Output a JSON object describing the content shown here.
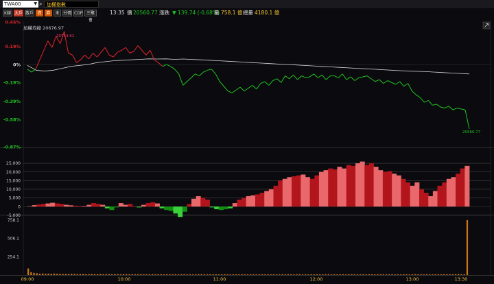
{
  "header": {
    "ticker_value": "TWA00",
    "index_name": "加權指數"
  },
  "toolbar": {
    "buttons": [
      "K線",
      "大戶",
      "散戶",
      "資",
      "券",
      "未",
      "分價",
      "CDP",
      "三聚會"
    ],
    "time": "13:35",
    "price_label": "價",
    "price_value": "20560.77",
    "change_label": "漲跌",
    "change_arrow": "▼",
    "change_value": "139.74 (-0.68%)",
    "volume_label": "量",
    "volume_value": "758.1 億",
    "total_label": "總量",
    "total_value": "4180.1 億"
  },
  "colors": {
    "up": "#e0252b",
    "down": "#21c321",
    "avg_line": "#d8d8d8",
    "accent": "#f4c430"
  },
  "chart_data": [
    {
      "type": "line",
      "title": "加權均線 20676.97",
      "ytick_labels": [
        "0.45%",
        "0.19%",
        "0%",
        "-0.19%",
        "-0.39%",
        "-0.58%",
        "-0.87%"
      ],
      "ytick_values": [
        0.45,
        0.19,
        0,
        -0.19,
        -0.39,
        -0.58,
        -0.87
      ],
      "ylim": [
        -0.87,
        0.45
      ],
      "xlabels": [
        "09:00",
        "10:00",
        "11:00",
        "12:00",
        "13:00",
        "13:30"
      ],
      "annotations": {
        "high": "20754.61",
        "last": "20560.77"
      },
      "series": [
        {
          "values": [
            -0.05,
            -0.08,
            -0.05,
            0.05,
            0.15,
            0.25,
            0.18,
            0.3,
            0.22,
            0.35,
            0.12,
            0.1,
            0.02,
            0.05,
            0.1,
            0.06,
            0.12,
            0.08,
            0.13,
            0.18,
            0.1,
            0.08,
            0.13,
            0.15,
            0.18,
            0.12,
            0.14,
            0.2,
            0.15,
            0.1,
            0.15,
            0.05,
            0.02,
            -0.02,
            0.0,
            -0.02,
            -0.05,
            -0.1,
            -0.22,
            -0.18,
            -0.14,
            -0.1,
            -0.12,
            -0.08,
            -0.06,
            -0.05,
            -0.1,
            -0.18,
            -0.23,
            -0.28,
            -0.3,
            -0.27,
            -0.24,
            -0.28,
            -0.25,
            -0.22,
            -0.26,
            -0.2,
            -0.18,
            -0.22,
            -0.17,
            -0.15,
            -0.19,
            -0.12,
            -0.15,
            -0.11,
            -0.16,
            -0.12,
            -0.14,
            -0.13,
            -0.1,
            -0.14,
            -0.11,
            -0.16,
            -0.12,
            -0.12,
            -0.14,
            -0.1,
            -0.16,
            -0.13,
            -0.17,
            -0.14,
            -0.13,
            -0.12,
            -0.15,
            -0.18,
            -0.16,
            -0.2,
            -0.17,
            -0.19,
            -0.21,
            -0.18,
            -0.23,
            -0.2,
            -0.28,
            -0.32,
            -0.35,
            -0.4,
            -0.38,
            -0.43,
            -0.42,
            -0.45,
            -0.46,
            -0.44,
            -0.48,
            -0.46,
            -0.47,
            -0.48,
            -0.68
          ]
        },
        {
          "values": [
            -0.01,
            -0.06,
            -0.07,
            -0.06,
            -0.04,
            -0.02,
            -0.01,
            0.0,
            0.02,
            0.03,
            0.04,
            0.045,
            0.05,
            0.055,
            0.06,
            0.058,
            0.06,
            0.055,
            0.058,
            0.054,
            0.05,
            0.045,
            0.04,
            0.035,
            0.03,
            0.025,
            0.02,
            0.015,
            0.01,
            0.005,
            0.0,
            -0.005,
            -0.01,
            -0.015,
            -0.02,
            -0.025,
            -0.03,
            -0.035,
            -0.04,
            -0.045,
            -0.05,
            -0.055,
            -0.06,
            -0.065,
            -0.07,
            -0.072,
            -0.075,
            -0.08,
            -0.085,
            -0.09,
            -0.095,
            -0.1
          ]
        }
      ]
    },
    {
      "type": "area",
      "ytick_labels": [
        "25,000",
        "20,000",
        "15,000",
        "10,000",
        "5,000",
        "0",
        "-5,000"
      ],
      "ytick_values": [
        25000,
        20000,
        15000,
        10000,
        5000,
        0,
        -5000
      ],
      "ylim": [
        -5500,
        27000
      ],
      "values": [
        200,
        800,
        1200,
        1500,
        1800,
        2200,
        1800,
        1500,
        1000,
        700,
        500,
        400,
        300,
        1000,
        2000,
        1500,
        1000,
        -1000,
        -2000,
        -500,
        2000,
        1000,
        1500,
        300,
        -500,
        1000,
        2000,
        2500,
        1800,
        -1000,
        -2000,
        -2500,
        -4000,
        -6000,
        -3000,
        1500,
        4500,
        6000,
        5000,
        4000,
        -500,
        -1500,
        -2000,
        -1500,
        -1000,
        2000,
        4000,
        5000,
        6000,
        6500,
        7000,
        8000,
        9000,
        10000,
        12000,
        15000,
        16000,
        17000,
        17500,
        18000,
        18500,
        17000,
        16000,
        18000,
        20000,
        21000,
        22000,
        21500,
        23000,
        22000,
        24000,
        23500,
        25000,
        26000,
        24000,
        25000,
        23000,
        21000,
        20000,
        20500,
        19000,
        18000,
        16000,
        14000,
        12000,
        14000,
        10000,
        8000,
        6000,
        9000,
        12000,
        14000,
        16000,
        17000,
        19000,
        22000,
        23500
      ]
    },
    {
      "type": "bar",
      "ytick_labels": [
        "758.1",
        "506.1",
        "254.1"
      ],
      "ytick_values": [
        758.1,
        506.1,
        254.1
      ],
      "ylim": [
        0,
        775
      ],
      "values": [
        90,
        40,
        30,
        25,
        20,
        22,
        18,
        20,
        19,
        21,
        18,
        17,
        16,
        17,
        15,
        18,
        16,
        14,
        15,
        16,
        14,
        13,
        15,
        14,
        13,
        16,
        12,
        14,
        13,
        12,
        15,
        13,
        12,
        14,
        13,
        12,
        13,
        11,
        12,
        13,
        12,
        11,
        12,
        13,
        11,
        12,
        12,
        11,
        13,
        12,
        11,
        12,
        11,
        12,
        13,
        11,
        12,
        10,
        11,
        12,
        13,
        11,
        10,
        12,
        11,
        12,
        10,
        11,
        12,
        11,
        10,
        12,
        11,
        10,
        12,
        11,
        10,
        11,
        12,
        10,
        11,
        12,
        10,
        11,
        10,
        12,
        11,
        10,
        11,
        10,
        12,
        11,
        10,
        11,
        12,
        10,
        11,
        10,
        11,
        10,
        12,
        11,
        10,
        11,
        12,
        10,
        11,
        10,
        11,
        12,
        10,
        11,
        12,
        11,
        10,
        11,
        12,
        10,
        11,
        12,
        10,
        11,
        12,
        11,
        10,
        11,
        12,
        10,
        11,
        10,
        12,
        11,
        10,
        11,
        12,
        10,
        11,
        10,
        12,
        11,
        10,
        11,
        12,
        11,
        13,
        12,
        11,
        12,
        13,
        14,
        12,
        11,
        758
      ]
    }
  ]
}
